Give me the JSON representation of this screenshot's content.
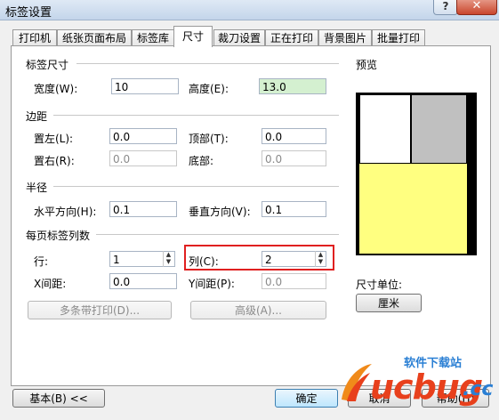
{
  "window": {
    "title": "标签设置",
    "help": "?",
    "close": "✕"
  },
  "tabs": [
    "打印机",
    "纸张页面布局",
    "标签库",
    "尺寸",
    "裁刀设置",
    "正在打印",
    "背景图片",
    "批量打印"
  ],
  "active_tab": "尺寸",
  "label_size": {
    "group": "标签尺寸",
    "width_label": "宽度(W):",
    "width_value": "10",
    "height_label": "高度(E):",
    "height_value": "13.0"
  },
  "margins": {
    "group": "边距",
    "left_label": "置左(L):",
    "left_value": "0.0",
    "top_label": "顶部(T):",
    "top_value": "0.0",
    "right_label": "置右(R):",
    "right_value": "0.0",
    "bottom_label": "底部:",
    "bottom_value": "0.0"
  },
  "radius": {
    "group": "半径",
    "h_label": "水平方向(H):",
    "h_value": "0.1",
    "v_label": "垂直方向(V):",
    "v_value": "0.1"
  },
  "per_page": {
    "group": "每页标签列数",
    "rows_label": "行:",
    "rows_value": "1",
    "cols_label": "列(C):",
    "cols_value": "2",
    "xgap_label": "X间距:",
    "xgap_value": "0.0",
    "ygap_label": "Y间距(P):",
    "ygap_value": "0.0",
    "multi_print": "多条带打印(D)...",
    "advanced": "高级(A)..."
  },
  "preview": {
    "title": "预览",
    "unit_label": "尺寸单位:",
    "unit_value": "厘米",
    "colors": {
      "label_fill": "#ffff80",
      "gray": "#c0c0c0",
      "border": "#000000"
    }
  },
  "footer": {
    "basic": "基本(B) <<",
    "ok": "确定",
    "cancel": "取消",
    "help": "帮助(H)"
  },
  "watermark": {
    "brand": "ucbug",
    "tld": ".cc",
    "tagline": "软件下载站"
  }
}
